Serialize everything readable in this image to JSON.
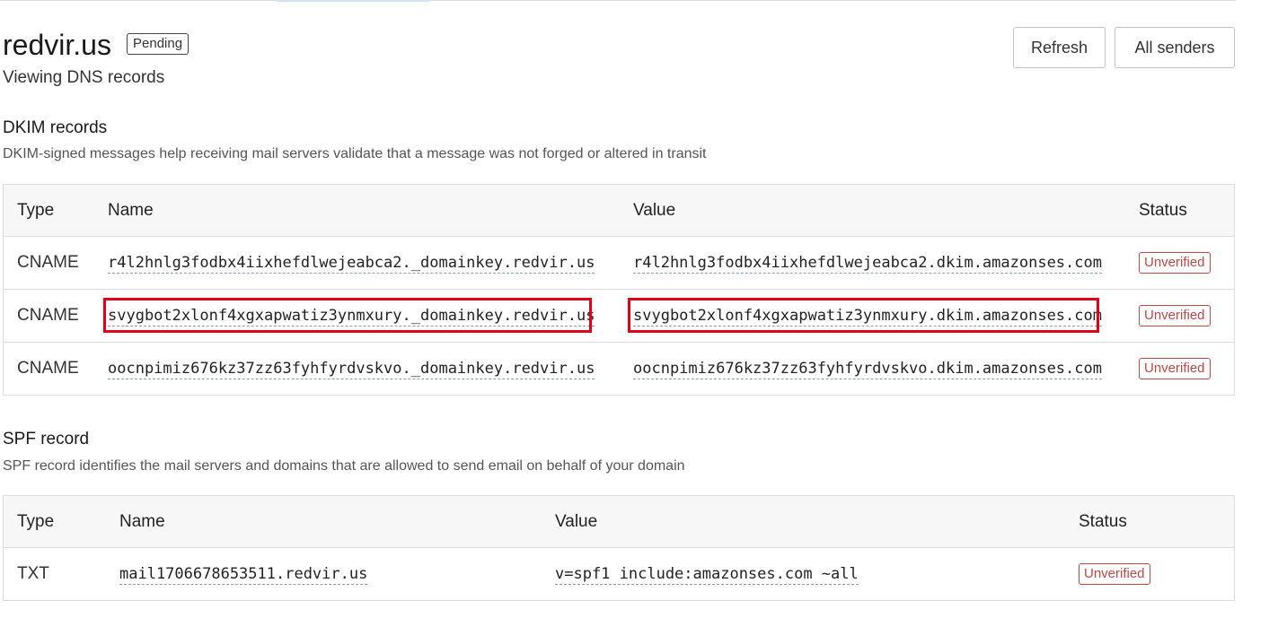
{
  "header": {
    "domain": "redvir.us",
    "badge": "Pending",
    "subtitle": "Viewing DNS records",
    "refresh_label": "Refresh",
    "all_senders_label": "All senders"
  },
  "dkim": {
    "title": "DKIM records",
    "description": "DKIM-signed messages help receiving mail servers validate that a message was not forged or altered in transit",
    "columns": [
      "Type",
      "Name",
      "Value",
      "Status"
    ],
    "rows": [
      {
        "type": "CNAME",
        "name": "r4l2hnlg3fodbx4iixhefdlwejeabca2._domainkey.redvir.us",
        "value": "r4l2hnlg3fodbx4iixhefdlwejeabca2.dkim.amazonses.com",
        "status": "Unverified"
      },
      {
        "type": "CNAME",
        "name": "svygbot2xlonf4xgxapwatiz3ynmxury._domainkey.redvir.us",
        "value": "svygbot2xlonf4xgxapwatiz3ynmxury.dkim.amazonses.com",
        "status": "Unverified"
      },
      {
        "type": "CNAME",
        "name": "oocnpimiz676kz37zz63fyhfyrdvskvo._domainkey.redvir.us",
        "value": "oocnpimiz676kz37zz63fyhfyrdvskvo.dkim.amazonses.com",
        "status": "Unverified"
      }
    ]
  },
  "spf": {
    "title": "SPF record",
    "description": "SPF record identifies the mail servers and domains that are allowed to send email on behalf of your domain",
    "columns": [
      "Type",
      "Name",
      "Value",
      "Status"
    ],
    "rows": [
      {
        "type": "TXT",
        "name": "mail1706678653511.redvir.us",
        "value": "v=spf1 include:amazonses.com ~all",
        "status": "Unverified"
      }
    ]
  },
  "colors": {
    "unverified": "#b94a48",
    "highlight": "#e0001a",
    "border": "#dcdcdc"
  }
}
